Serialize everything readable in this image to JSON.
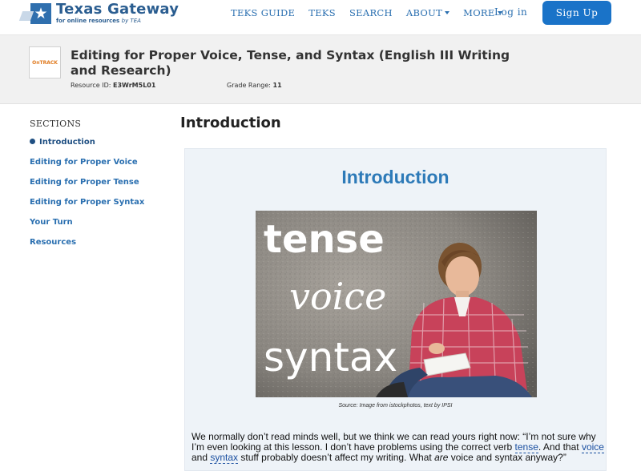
{
  "header": {
    "logo_title": "Texas Gateway",
    "logo_subtitle": "for online resources",
    "logo_subtitle_by": "by TEA",
    "nav": [
      {
        "label": "TEKS GUIDE",
        "dropdown": false
      },
      {
        "label": "TEKS",
        "dropdown": false
      },
      {
        "label": "SEARCH",
        "dropdown": false
      },
      {
        "label": "ABOUT",
        "dropdown": true
      },
      {
        "label": "MORE",
        "dropdown": true
      }
    ],
    "login_label": "Log in",
    "signup_label": "Sign Up"
  },
  "resource": {
    "thumb_label": "OnTRACK",
    "title": "Editing for Proper Voice, Tense, and Syntax (English III Writing and Research)",
    "id_label": "Resource ID:",
    "id_value": "E3WrM5L01",
    "grade_label": "Grade Range:",
    "grade_value": "11"
  },
  "sidebar": {
    "heading": "SECTIONS",
    "items": [
      {
        "label": "Introduction",
        "active": true
      },
      {
        "label": "Editing for Proper Voice",
        "active": false
      },
      {
        "label": "Editing for Proper Tense",
        "active": false
      },
      {
        "label": "Editing for Proper Syntax",
        "active": false
      },
      {
        "label": "Your Turn",
        "active": false
      },
      {
        "label": "Resources",
        "active": false
      }
    ]
  },
  "main": {
    "page_title": "Introduction",
    "content_heading": "Introduction",
    "image_words": [
      "tense",
      "voice",
      "syntax"
    ],
    "image_caption": "Source: Image from istockphotos, text by IPSI",
    "para_1": "We normally don’t read minds well, but we think we can read yours right now: “I’m not sure why I’m even looking at this lesson. I don’t have problems using the correct verb ",
    "para_link_tense": "tense",
    "para_2": ". And that ",
    "para_link_voice": "voice",
    "para_3": " and ",
    "para_link_syntax": "syntax",
    "para_4": " stuff probably doesn’t affect my writing. What ",
    "para_em": "are",
    "para_5": " voice and syntax anyway?”"
  },
  "colors": {
    "brand_blue": "#2a5d90",
    "link_blue": "#2a6fb0",
    "signup_bg": "#1a73c8",
    "content_bg": "#eef3f8",
    "heading_blue": "#2d7ab8"
  }
}
